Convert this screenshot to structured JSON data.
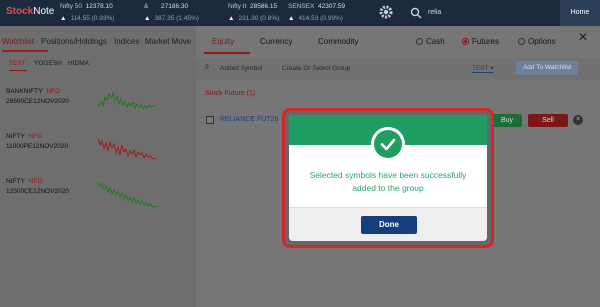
{
  "app": {
    "logo_main": "Stock",
    "logo_sub": "Note"
  },
  "tickers": [
    {
      "name": "Nifty 50",
      "value": "12378.10",
      "change": "114.55 (0.93%)"
    },
    {
      "name": "&",
      "value": "27186.30",
      "change": "387.35 (1.45%)"
    },
    {
      "name": "Nifty It",
      "value": "28586.15",
      "change": "231.30 (0.8%)"
    },
    {
      "name": "SENSEX",
      "value": "42307.59",
      "change": "414.53 (0.99%)"
    }
  ],
  "top_search": {
    "value": "relia"
  },
  "home_label": "Home",
  "left_tabs": [
    "Watchlist",
    "Positions/Holdings",
    "Indices",
    "Market Move"
  ],
  "watchlist_tabs": [
    "TEST",
    "YOGESH",
    "HIDMA"
  ],
  "watchlist": [
    {
      "symbol": "BANKNIFTY",
      "exchange": "NFO",
      "contract": "28500CE12NOV2020",
      "trend": "up",
      "color": "#1f7a1f"
    },
    {
      "symbol": "NIFTY",
      "exchange": "NFO",
      "contract": "11000PE12NOV2020",
      "trend": "down",
      "color": "#a11b1b"
    },
    {
      "symbol": "NIFTY",
      "exchange": "NFO",
      "contract": "12500CE12NOV2020",
      "trend": "down",
      "color": "#1f7a1f"
    }
  ],
  "modal": {
    "tabs": [
      "Equity",
      "Currency",
      "Commodity"
    ],
    "radios": [
      {
        "label": "Cash",
        "selected": false
      },
      {
        "label": "Futures",
        "selected": true
      },
      {
        "label": "Options",
        "selected": false
      }
    ],
    "added_count": "0",
    "added_label": "Added Symbol",
    "group_placeholder": "Create Or Select Group",
    "group_selected": "TEST",
    "add_button": "Add To Watchlist",
    "section_title": "Stock Future (1)",
    "row": {
      "symbol": "RELIANCE FUT26",
      "buy": "Buy",
      "sell": "Sell",
      "remove": "×"
    }
  },
  "popup": {
    "message": "Selected symbols have been successfully added to the group",
    "done": "Done"
  },
  "colors": {
    "accent_green": "#1f9d63",
    "accent_red": "#d42727",
    "primary_blue": "#163e7d"
  }
}
